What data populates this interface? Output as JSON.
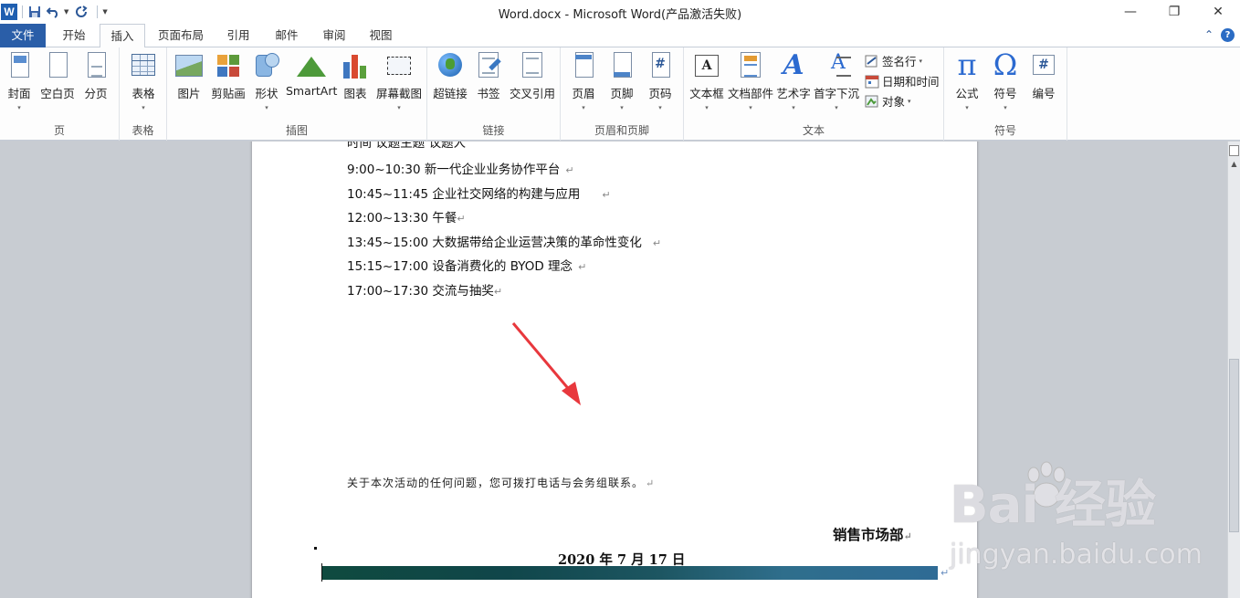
{
  "window": {
    "title": "Word.docx  -  Microsoft Word(产品激活失败)",
    "app_icon": "W",
    "controls": {
      "minimize": "—",
      "maximize": "❐",
      "close": "✕"
    }
  },
  "quick_access": {
    "save": "save-icon",
    "undo": "undo-icon",
    "redo": "redo-icon"
  },
  "tabs": [
    {
      "label": "文件"
    },
    {
      "label": "开始"
    },
    {
      "label": "插入"
    },
    {
      "label": "页面布局"
    },
    {
      "label": "引用"
    },
    {
      "label": "邮件"
    },
    {
      "label": "审阅"
    },
    {
      "label": "视图"
    }
  ],
  "tab_right": {
    "collapse": "⌃",
    "help": "?"
  },
  "ribbon": {
    "groups": {
      "page": "页",
      "table": "表格",
      "illustrations": "插图",
      "links": "链接",
      "header_footer": "页眉和页脚",
      "text": "文本",
      "symbols": "符号"
    },
    "buttons": {
      "cover": "封面",
      "blank_page": "空白页",
      "page_break": "分页",
      "table": "表格",
      "picture": "图片",
      "clipart": "剪贴画",
      "shapes": "形状",
      "smartart": "SmartArt",
      "chart": "图表",
      "screenshot": "屏幕截图",
      "hyperlink": "超链接",
      "bookmark": "书签",
      "cross_ref": "交叉引用",
      "header": "页眉",
      "footer": "页脚",
      "page_number": "页码",
      "textbox": "文本框",
      "quick_parts": "文档部件",
      "wordart": "艺术字",
      "dropcap": "首字下沉",
      "signature": "签名行",
      "datetime": "日期和时间",
      "object": "对象",
      "equation": "公式",
      "symbol": "符号",
      "number": "编号"
    },
    "dropdown_marker": "▾"
  },
  "document": {
    "partial_top_line": "时间    议题主题    议题人",
    "schedule": [
      {
        "text": "9:00~10:30   新一代企业业务协作平台"
      },
      {
        "text": "10:45~11:45 企业社交网络的构建与应用"
      },
      {
        "text": "12:00~13:30 午餐"
      },
      {
        "text": "13:45~15:00 大数据带给企业运营决策的革命性变化"
      },
      {
        "text": "15:15~17:00 设备消费化的 BYOD 理念"
      },
      {
        "text": "17:00~17:30 交流与抽奖"
      }
    ],
    "paragraph_mark": "↵",
    "note": "关于本次活动的任何问题，您可拨打电话与会务组联系。",
    "signer": "销售市场部",
    "date": "2020 年 7 月 17 日"
  },
  "watermark": {
    "brand": "Bai   经验",
    "url": "jingyan.baidu.com"
  },
  "annotation": {
    "arrow_color": "#e8383d"
  }
}
